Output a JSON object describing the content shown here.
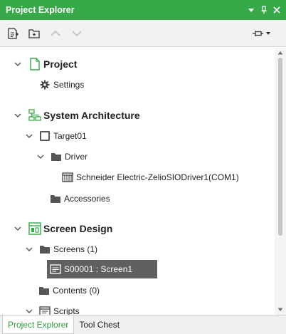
{
  "panel": {
    "title": "Project Explorer"
  },
  "colors": {
    "accent": "#38a948",
    "selection": "#606060",
    "folder": "#555555"
  },
  "toolbar": {
    "buttons": [
      {
        "icon": "new-item-icon"
      },
      {
        "icon": "new-folder-icon"
      },
      {
        "icon": "move-up-icon",
        "disabled": true
      },
      {
        "icon": "move-down-icon",
        "disabled": true
      }
    ],
    "pin_dropdown_icon": "pin-dropdown-icon"
  },
  "tree": {
    "project": {
      "label": "Project",
      "settings": "Settings"
    },
    "system_architecture": {
      "label": "System Architecture",
      "target": "Target01",
      "driver": "Driver",
      "driver_item": "Schneider Electric-ZelioSIODriver1(COM1)",
      "accessories": "Accessories"
    },
    "screen_design": {
      "label": "Screen Design",
      "screens": "Screens (1)",
      "screen_item": "S00001 : Screen1",
      "contents": "Contents (0)",
      "scripts": "Scripts"
    }
  },
  "bottom_tabs": [
    {
      "label": "Project Explorer",
      "active": true
    },
    {
      "label": "Tool Chest",
      "active": false
    }
  ]
}
